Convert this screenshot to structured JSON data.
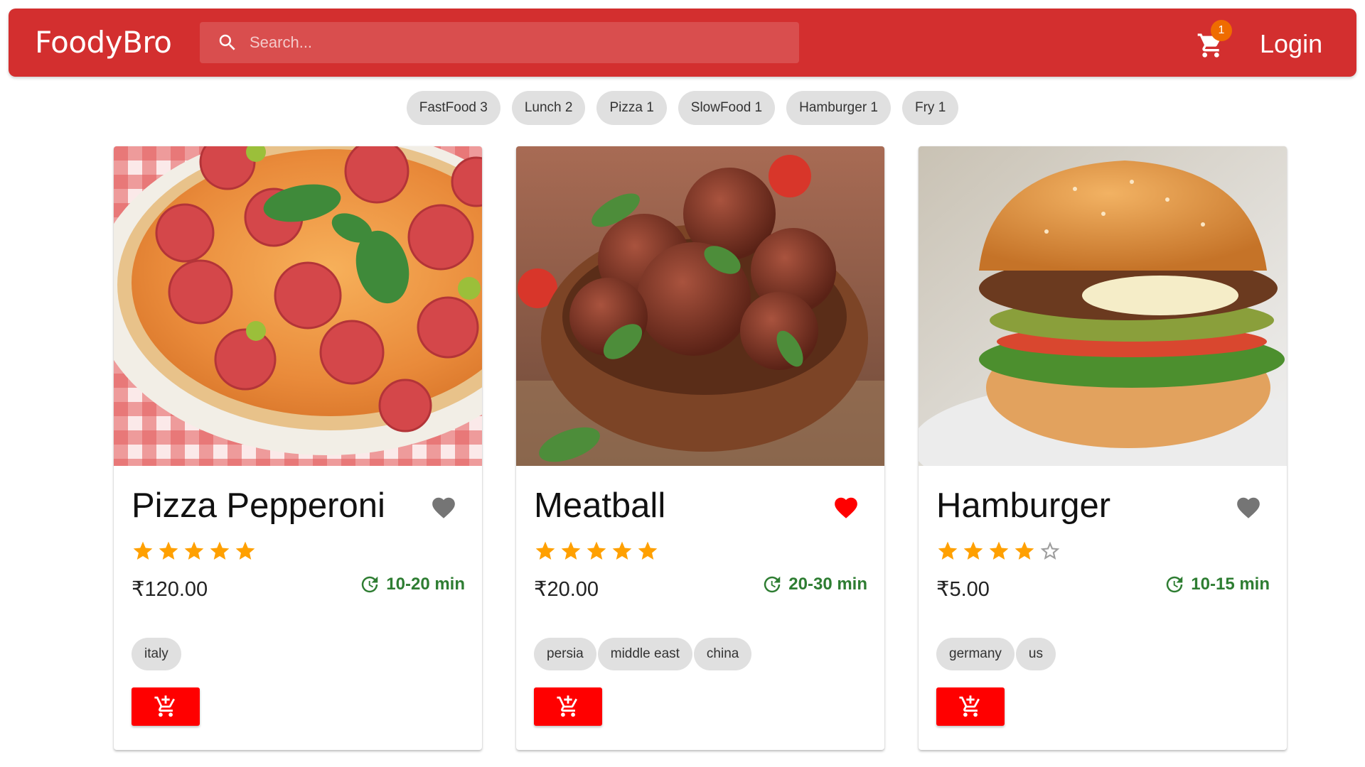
{
  "app": {
    "brand": "FoodyBro"
  },
  "search": {
    "placeholder": "Search..."
  },
  "cart": {
    "count": "1",
    "icon": "cart-icon"
  },
  "login": {
    "label": "Login"
  },
  "tags_bar": [
    {
      "label": "FastFood 3"
    },
    {
      "label": "Lunch 2"
    },
    {
      "label": "Pizza 1"
    },
    {
      "label": "SlowFood 1"
    },
    {
      "label": "Hamburger 1"
    },
    {
      "label": "Fry 1"
    }
  ],
  "colors": {
    "primary": "#d32f2f",
    "accent": "#ff0000",
    "star": "#ffa000",
    "time": "#2e7d32",
    "favorite": "#ff0000",
    "not_favorite": "#757575"
  },
  "foods": [
    {
      "name": "Pizza Pepperoni",
      "stars": 5,
      "price": "₹120.00",
      "cook_time": "10-20 min",
      "favorite": false,
      "origins": [
        "italy"
      ]
    },
    {
      "name": "Meatball",
      "stars": 5,
      "price": "₹20.00",
      "cook_time": "20-30 min",
      "favorite": true,
      "origins": [
        "persia",
        "middle east",
        "china"
      ]
    },
    {
      "name": "Hamburger",
      "stars": 4,
      "price": "₹5.00",
      "cook_time": "10-15 min",
      "favorite": false,
      "origins": [
        "germany",
        "us"
      ]
    }
  ]
}
